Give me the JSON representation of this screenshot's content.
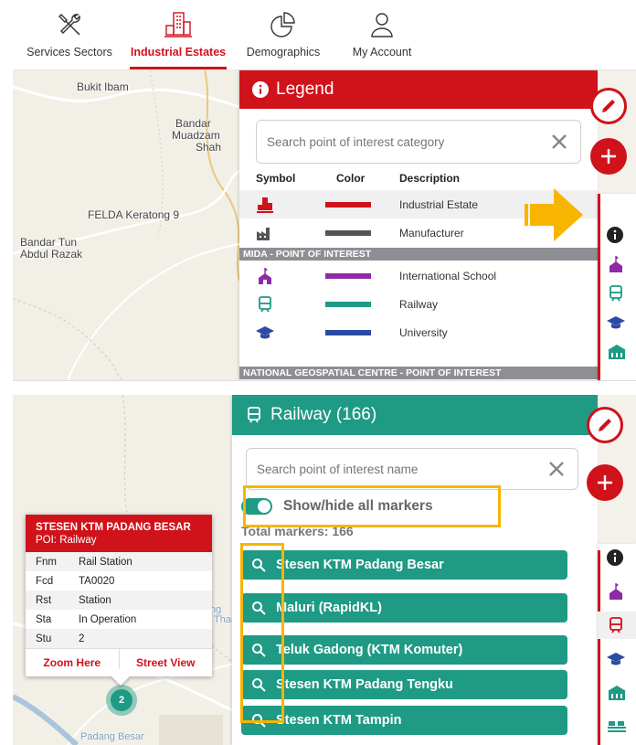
{
  "nav": {
    "items": [
      {
        "label": "Services Sectors",
        "icon": "tools-icon"
      },
      {
        "label": "Industrial Estates",
        "icon": "buildings-icon",
        "active": true
      },
      {
        "label": "Demographics",
        "icon": "pie-chart-icon"
      },
      {
        "label": "My Account",
        "icon": "user-icon"
      }
    ]
  },
  "map1": {
    "labels": [
      "Bukit Ibam",
      "Bandar",
      "Muadzam",
      "Shah",
      "FELDA Keratong 9",
      "Bandar Tun",
      "Abdul Razak"
    ]
  },
  "legend": {
    "title": "Legend",
    "search_placeholder": "Search point of interest category",
    "columns": {
      "symbol": "Symbol",
      "color": "Color",
      "description": "Description"
    },
    "rows": [
      {
        "description": "Industrial Estate",
        "color": "#d0121b",
        "icon": "industrial-estate-icon"
      },
      {
        "description": "Manufacturer",
        "color": "#555555",
        "icon": "factory-icon"
      }
    ],
    "section1": "MIDA - POINT OF INTEREST",
    "rows2": [
      {
        "description": "International School",
        "color": "#8e2aa6",
        "icon": "school-icon"
      },
      {
        "description": "Railway",
        "color": "#1f9a84",
        "icon": "train-icon"
      },
      {
        "description": "University",
        "color": "#2c4aa3",
        "icon": "graduation-cap-icon"
      }
    ],
    "section2": "NATIONAL GEOSPATIAL CENTRE - POINT OF INTEREST"
  },
  "railway": {
    "title": "Railway (166)",
    "search_placeholder": "Search point of interest name",
    "toggle_label": "Show/hide all markers",
    "total": "Total markers: 166",
    "items": [
      "Stesen KTM Padang Besar",
      "Maluri (RapidKL)",
      "Teluk Gadong (KTM Komuter)",
      "Stesen KTM Padang Tengku",
      "Stesen KTM Tampin"
    ]
  },
  "popup": {
    "title": "STESEN KTM PADANG BESAR",
    "subtitle": "POI: Railway",
    "rows": [
      {
        "k": "Fnm",
        "v": "Rail Station"
      },
      {
        "k": "Fcd",
        "v": "TA0020"
      },
      {
        "k": "Rst",
        "v": "Station"
      },
      {
        "k": "Sta",
        "v": "In Operation"
      },
      {
        "k": "Stu",
        "v": "2"
      }
    ],
    "zoom": "Zoom Here",
    "street": "Street View"
  },
  "map2": {
    "cluster_count": "2",
    "labels": [
      "Padang Besar",
      "ng",
      "Thai)"
    ]
  },
  "colors": {
    "brand_red": "#d0121b",
    "railway_green": "#1f9a84",
    "highlight": "#f7b500"
  }
}
